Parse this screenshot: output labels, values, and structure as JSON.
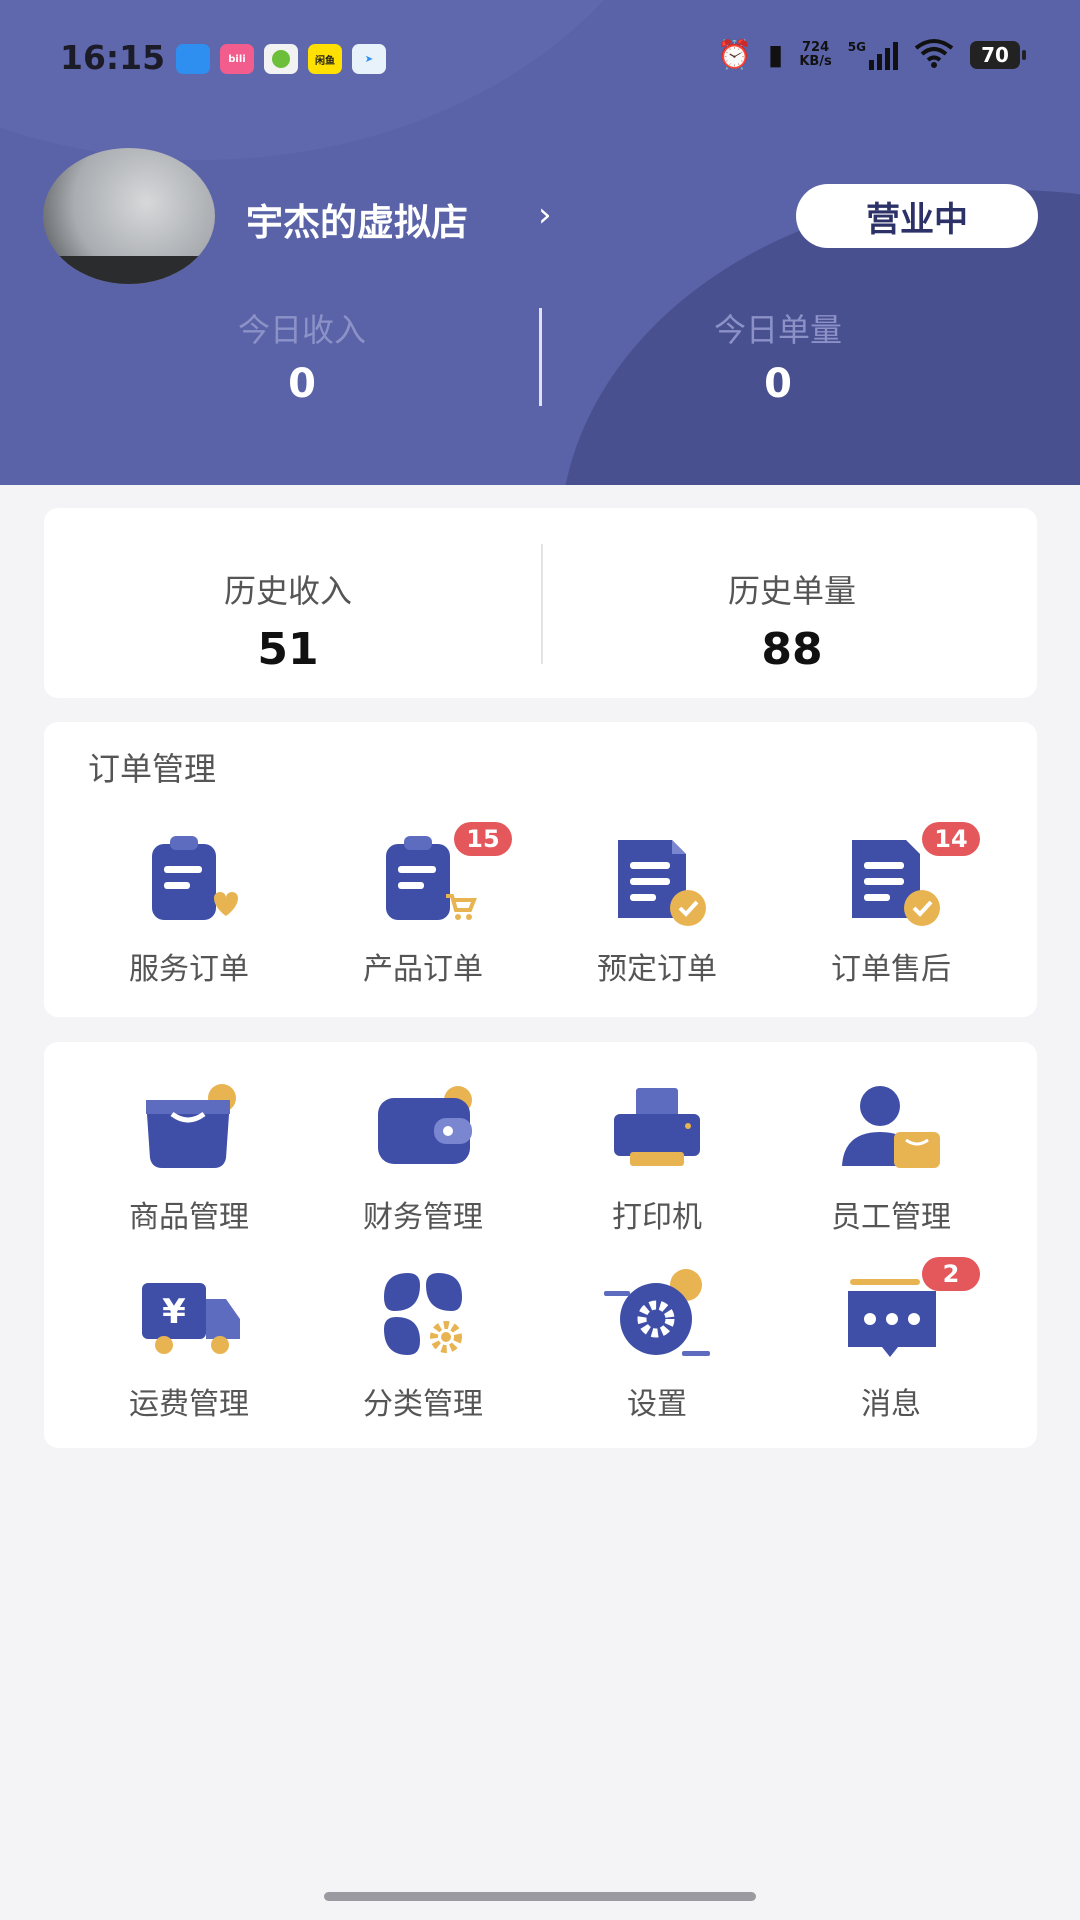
{
  "status_bar": {
    "time": "16:15",
    "apps": [
      {
        "icon": "bird-app-icon",
        "text": "",
        "color": "#2f8ff0"
      },
      {
        "icon": "bilibili-app-icon",
        "text": "bili",
        "color": "#f25d8e"
      },
      {
        "icon": "pinduoduo-app-icon",
        "text": "",
        "color": "#f2f2f2"
      },
      {
        "icon": "yellow-app-icon",
        "text": "闲鱼",
        "color": "#ffe000"
      },
      {
        "icon": "telegram-app-icon",
        "text": "",
        "color": "#e8f2fb"
      }
    ],
    "network_speed_value": "724",
    "network_speed_unit": "KB/s",
    "signal_label": "5G",
    "battery": "70"
  },
  "header": {
    "store_name": "宇杰的虚拟店",
    "status_button": "营业中",
    "today_income_label": "今日收入",
    "today_income_value": "0",
    "today_orders_label": "今日单量",
    "today_orders_value": "0"
  },
  "history": {
    "income_label": "历史收入",
    "income_value": "51",
    "orders_label": "历史单量",
    "orders_value": "88"
  },
  "order_management": {
    "title": "订单管理",
    "items": [
      {
        "label": "服务订单",
        "icon": "service-order-icon",
        "badge": ""
      },
      {
        "label": "产品订单",
        "icon": "product-order-icon",
        "badge": "15"
      },
      {
        "label": "预定订单",
        "icon": "reservation-order-icon",
        "badge": ""
      },
      {
        "label": "订单售后",
        "icon": "after-sales-icon",
        "badge": "14"
      }
    ]
  },
  "tools": {
    "items": [
      {
        "label": "商品管理",
        "icon": "goods-bag-icon",
        "badge": ""
      },
      {
        "label": "财务管理",
        "icon": "wallet-icon",
        "badge": ""
      },
      {
        "label": "打印机",
        "icon": "printer-icon",
        "badge": ""
      },
      {
        "label": "员工管理",
        "icon": "staff-icon",
        "badge": ""
      },
      {
        "label": "运费管理",
        "icon": "delivery-truck-icon",
        "badge": ""
      },
      {
        "label": "分类管理",
        "icon": "category-icon",
        "badge": ""
      },
      {
        "label": "设置",
        "icon": "settings-gear-icon",
        "badge": ""
      },
      {
        "label": "消息",
        "icon": "message-icon",
        "badge": "2"
      }
    ]
  },
  "colors": {
    "header_bg": "#5a63a8",
    "icon_blue": "#3f4fa8",
    "icon_gold": "#e8b452",
    "badge_red": "#e4575a",
    "page_bg": "#f4f4f6"
  }
}
